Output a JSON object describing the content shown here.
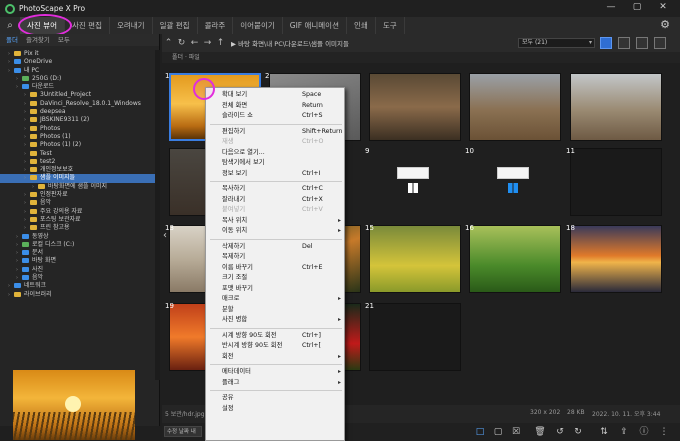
{
  "window": {
    "title": "PhotoScape X Pro",
    "controls": [
      "—",
      "▢",
      "✕"
    ]
  },
  "menubar": {
    "search_icon": "⌕",
    "tabs": [
      "사진 뷰어",
      "사진 편집",
      "오려내기",
      "일괄 편집",
      "콜라주",
      "이어붙이기",
      "GIF 애니메이션",
      "인쇄",
      "도구"
    ],
    "active": "사진 뷰어",
    "gear_icon": "⚙"
  },
  "left_panel": {
    "tabs": [
      "폴더",
      "즐겨찾기",
      "모두"
    ],
    "tree": [
      {
        "label": "Pix it",
        "icon": "folder",
        "indent": 1
      },
      {
        "label": "OneDrive",
        "icon": "blue",
        "indent": 1
      },
      {
        "label": "내 PC",
        "icon": "blue",
        "indent": 1
      },
      {
        "label": "250G (D:)",
        "icon": "drive",
        "indent": 2
      },
      {
        "label": "다운로드",
        "icon": "blue",
        "indent": 2
      },
      {
        "label": "3Untitled_Project",
        "icon": "folder",
        "indent": 3
      },
      {
        "label": "DaVinci_Resolve_18.0.1_Windows",
        "icon": "folder",
        "indent": 3
      },
      {
        "label": "deepsea",
        "icon": "folder",
        "indent": 3
      },
      {
        "label": "JBSKINE9311 (2)",
        "icon": "folder",
        "indent": 3
      },
      {
        "label": "Photos",
        "icon": "folder",
        "indent": 3
      },
      {
        "label": "Photos (1)",
        "icon": "folder",
        "indent": 3
      },
      {
        "label": "Photos (1) (2)",
        "icon": "folder",
        "indent": 3
      },
      {
        "label": "Test",
        "icon": "folder",
        "indent": 3
      },
      {
        "label": "test2",
        "icon": "folder",
        "indent": 3
      },
      {
        "label": "개인정보보호",
        "icon": "folder",
        "indent": 3
      },
      {
        "label": "샘플 이미지들",
        "icon": "folder",
        "indent": 3,
        "selected": true
      },
      {
        "label": "바탕화면에 샘플 이미지",
        "icon": "folder",
        "indent": 4
      },
      {
        "label": "인정판자료",
        "icon": "folder",
        "indent": 3
      },
      {
        "label": "음악",
        "icon": "folder",
        "indent": 3
      },
      {
        "label": "주요 강의용 자료",
        "icon": "folder",
        "indent": 3
      },
      {
        "label": "포스팅 보관자료",
        "icon": "folder",
        "indent": 3
      },
      {
        "label": "프린 참고용",
        "icon": "folder",
        "indent": 3
      },
      {
        "label": "동영상",
        "icon": "blue",
        "indent": 2
      },
      {
        "label": "로컬 디스크 (C:)",
        "icon": "drive",
        "indent": 2
      },
      {
        "label": "문서",
        "icon": "blue",
        "indent": 2
      },
      {
        "label": "바탕 화면",
        "icon": "blue",
        "indent": 2
      },
      {
        "label": "사진",
        "icon": "blue",
        "indent": 2
      },
      {
        "label": "음악",
        "icon": "blue",
        "indent": 2
      },
      {
        "label": "네트워크",
        "icon": "blue",
        "indent": 1
      },
      {
        "label": "라이브러리",
        "icon": "folder",
        "indent": 1
      }
    ]
  },
  "pathbar": {
    "path": "▶ 바탕 화면\\내 PC\\다운로드\\샘플 이미지들",
    "sort": "모두 (21)",
    "sort_chevron": "▾"
  },
  "subbar": {
    "text": "폴더 · 파일"
  },
  "grid": {
    "cells": [
      {
        "num": "1",
        "kind": "sunset_grass",
        "selected": true
      },
      {
        "num": "2",
        "kind": "gray_photo"
      },
      {
        "num": "",
        "kind": "signboard"
      },
      {
        "num": "",
        "kind": "forest"
      },
      {
        "num": "",
        "kind": "road"
      },
      {
        "num": "",
        "kind": "dark_forest"
      },
      {
        "num": "8",
        "kind": "forest_ground",
        "play": true
      },
      {
        "num": "9",
        "kind": "windows10",
        "play": true
      },
      {
        "num": "10",
        "kind": "windows11"
      },
      {
        "num": "11",
        "kind": "dark"
      },
      {
        "num": "13",
        "kind": "carving"
      },
      {
        "num": "14",
        "kind": "tiger"
      },
      {
        "num": "15",
        "kind": "field"
      },
      {
        "num": "16",
        "kind": "grass"
      },
      {
        "num": "18",
        "kind": "sea_sunset"
      },
      {
        "num": "19",
        "kind": "orange_sunset"
      },
      {
        "num": "20",
        "kind": "flowers"
      },
      {
        "num": "21",
        "kind": "dark"
      }
    ],
    "left_arrow": "‹"
  },
  "status": {
    "left": "5 보관/hdr.jpg",
    "size": "320 x 202",
    "bytes": "28 KB",
    "date": "2022. 10. 11. 오후 3:44"
  },
  "bottombar": {
    "sort_label": "수정 날짜 내",
    "icons": [
      "□",
      "▢",
      "☒",
      "🗑",
      "↺",
      "↻",
      "⇅",
      "⇪",
      "ⓘ",
      "⋮"
    ]
  },
  "context_menu": {
    "items": [
      {
        "label": "확대 보기",
        "shortcut": "Space"
      },
      {
        "label": "전체 화면",
        "shortcut": "Return"
      },
      {
        "label": "슬라이드 쇼",
        "shortcut": "Ctrl+S"
      },
      {
        "sep": true
      },
      {
        "label": "편집하기",
        "shortcut": "Shift+Return"
      },
      {
        "label": "재생",
        "shortcut": "Ctrl+O",
        "disabled": true
      },
      {
        "label": "다음으로 열기...",
        "shortcut": ""
      },
      {
        "label": "탐색기에서 보기",
        "shortcut": ""
      },
      {
        "label": "정보 보기",
        "shortcut": "Ctrl+I"
      },
      {
        "sep": true
      },
      {
        "label": "복사하기",
        "shortcut": "Ctrl+C"
      },
      {
        "label": "잘라내기",
        "shortcut": "Ctrl+X"
      },
      {
        "label": "붙여넣기",
        "shortcut": "Ctrl+V",
        "disabled": true
      },
      {
        "label": "복사 위치",
        "shortcut": "",
        "submenu": true
      },
      {
        "label": "이동 위치",
        "shortcut": "",
        "submenu": true
      },
      {
        "sep": true
      },
      {
        "label": "삭제하기",
        "shortcut": "Del"
      },
      {
        "label": "복제하기",
        "shortcut": ""
      },
      {
        "label": "이름 바꾸기",
        "shortcut": "Ctrl+E"
      },
      {
        "label": "크기 조절",
        "shortcut": ""
      },
      {
        "label": "포맷 바꾸기",
        "shortcut": ""
      },
      {
        "label": "매크로",
        "shortcut": "",
        "submenu": true
      },
      {
        "label": "분할",
        "shortcut": ""
      },
      {
        "label": "사진 병합",
        "shortcut": "",
        "submenu": true
      },
      {
        "sep": true
      },
      {
        "label": "시계 방향 90도 회전",
        "shortcut": "Ctrl+]"
      },
      {
        "label": "반시계 방향 90도 회전",
        "shortcut": "Ctrl+["
      },
      {
        "label": "회전",
        "shortcut": "",
        "submenu": true
      },
      {
        "sep": true
      },
      {
        "label": "메타데이터",
        "shortcut": "",
        "submenu": true
      },
      {
        "label": "플래그",
        "shortcut": "",
        "submenu": true
      },
      {
        "sep": true
      },
      {
        "label": "공유",
        "shortcut": ""
      },
      {
        "label": "설정",
        "shortcut": ""
      }
    ]
  }
}
